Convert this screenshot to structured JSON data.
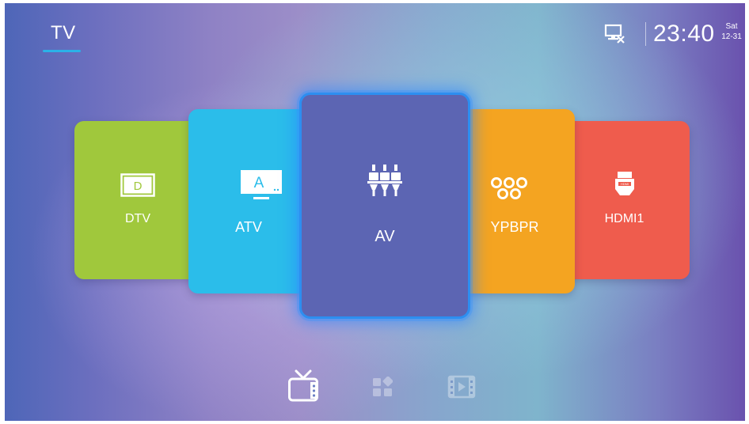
{
  "header": {
    "tab_title": "TV",
    "status_icon": "screen-cast-off-icon",
    "clock": "23:40",
    "day": "Sat",
    "date": "12-31",
    "accent_color": "#2ab2e8"
  },
  "sources": [
    {
      "label": "DTV",
      "icon": "dtv-icon",
      "icon_text": "D",
      "color": "#a0c83c"
    },
    {
      "label": "ATV",
      "icon": "atv-icon",
      "icon_text": "A",
      "color": "#2bbdea"
    },
    {
      "label": "AV",
      "icon": "av-connector-icon",
      "color": "#5c65b3",
      "selected": true
    },
    {
      "label": "YPBPR",
      "icon": "component-ports-icon",
      "color": "#f4a421"
    },
    {
      "label": "HDMI1",
      "icon": "hdmi-connector-icon",
      "icon_text": "HDMI",
      "color": "#ef5c4d"
    }
  ],
  "bottom_nav": [
    {
      "icon": "tv-icon",
      "active": true
    },
    {
      "icon": "apps-icon",
      "active": false
    },
    {
      "icon": "media-player-icon",
      "active": false
    }
  ]
}
